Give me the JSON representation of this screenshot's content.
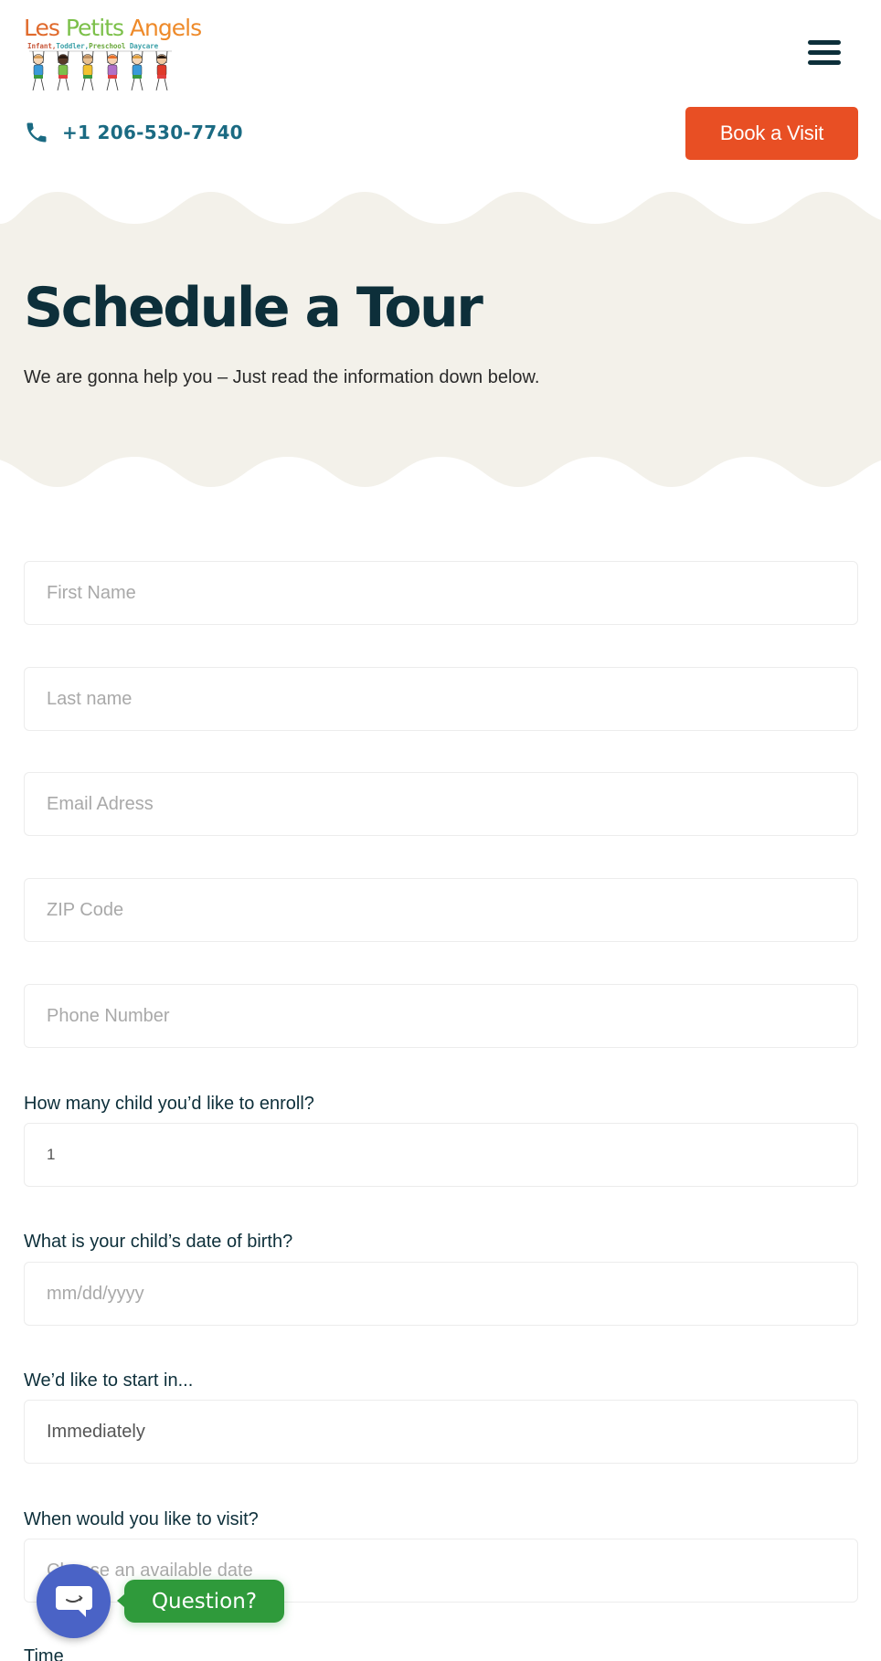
{
  "header": {
    "logo": {
      "title_words": [
        "Les",
        "Petits",
        "Angels"
      ],
      "tagline_parts": [
        "Infant,",
        "Toddler,",
        "Preschool",
        "Daycare"
      ],
      "kid_shirt_colors": [
        "#3a9ad9",
        "#7cc04a",
        "#f2c230",
        "#b070c8",
        "#3a9ad9",
        "#e03a2a"
      ]
    },
    "menu_icon": "hamburger-menu-icon",
    "phone": {
      "icon": "phone-icon",
      "number": "+1 206-530-7740"
    },
    "book_button_label": "Book a Visit"
  },
  "hero": {
    "title": "Schedule a Tour",
    "subtitle": "We are gonna help you – Just read the information down below."
  },
  "form": {
    "first_name": {
      "placeholder": "First Name",
      "value": ""
    },
    "last_name": {
      "placeholder": "Last name",
      "value": ""
    },
    "email": {
      "placeholder": "Email Adress",
      "value": ""
    },
    "zip": {
      "placeholder": "ZIP Code",
      "value": ""
    },
    "phone": {
      "placeholder": "Phone Number",
      "value": ""
    },
    "children_count": {
      "label": "How many child you’d like to enroll?",
      "value": "1"
    },
    "dob": {
      "label": "What is your child’s date of birth?",
      "placeholder": "mm/dd/yyyy"
    },
    "start": {
      "label": "We’d like to start in...",
      "value": "Immediately"
    },
    "visit_date": {
      "label": "When would you like to visit?",
      "placeholder": "Choose an available date"
    },
    "time": {
      "label": "Time"
    }
  },
  "chat_widget": {
    "icon": "chat-bubble-icon",
    "tooltip": "Question?"
  },
  "colors": {
    "accent": "#e84f24",
    "heading": "#0d2f3a",
    "phone": "#1a6a82",
    "hero_bg": "#f3f1ea",
    "chat_button": "#4a63c6",
    "chat_tooltip": "#2f9a3b"
  }
}
